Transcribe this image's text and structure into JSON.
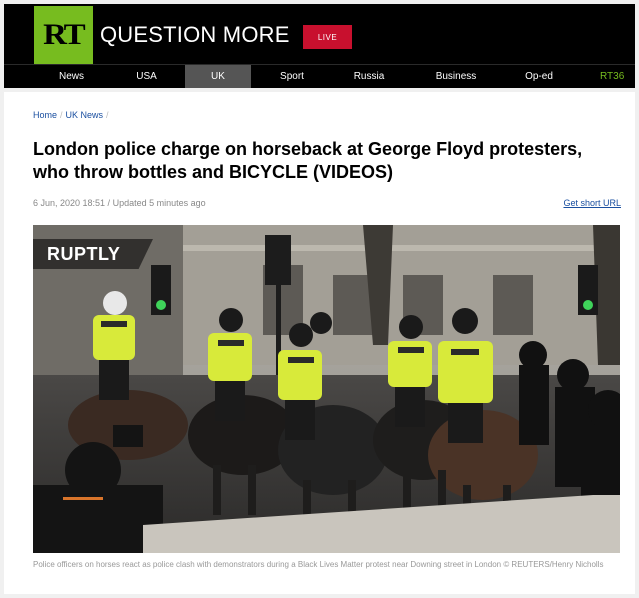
{
  "header": {
    "logo": "RT",
    "brand": "QUESTION MORE",
    "live_label": "LIVE"
  },
  "nav": [
    {
      "label": "News",
      "active": false
    },
    {
      "label": "USA",
      "active": false
    },
    {
      "label": "UK",
      "active": true
    },
    {
      "label": "Sport",
      "active": false
    },
    {
      "label": "Russia",
      "active": false
    },
    {
      "label": "Business",
      "active": false
    },
    {
      "label": "Op-ed",
      "active": false
    },
    {
      "label": "RT36",
      "active": false
    }
  ],
  "breadcrumb": [
    {
      "label": "Home"
    },
    {
      "label": "UK News"
    }
  ],
  "article": {
    "title": "London police charge on horseback at George Floyd protesters, who throw bottles and BICYCLE (VIDEOS)",
    "meta": "6 Jun, 2020 18:51 / Updated 5 minutes ago",
    "short_url": "Get short URL",
    "photo_watermark": "RUPTLY",
    "caption": "Police officers on horses react as police clash with demonstrators during a Black Lives Matter protest near Downing street in London © REUTERS/Henry Nicholls"
  },
  "colors": {
    "brand_green": "#77bc1f",
    "live_red": "#c8102e",
    "link_blue": "#1a4fa0"
  }
}
